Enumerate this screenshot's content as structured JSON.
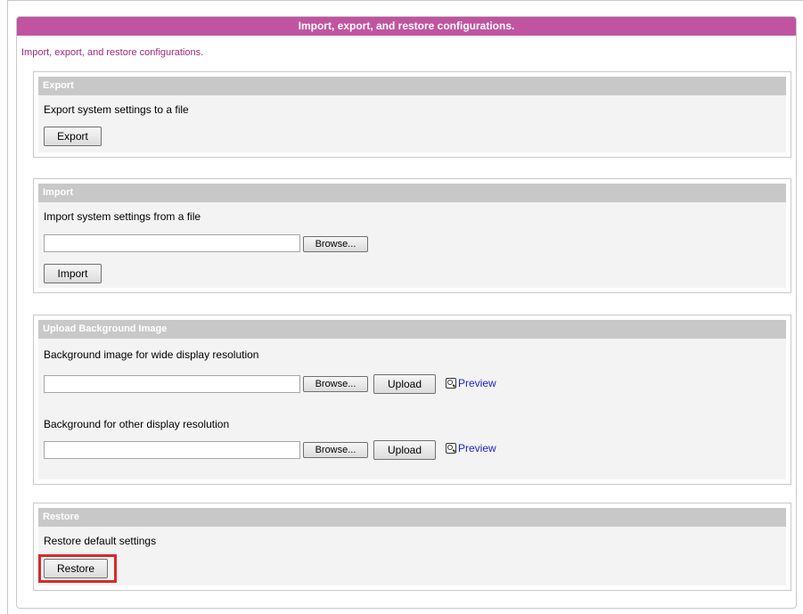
{
  "colors": {
    "header_bg": "#c154a0",
    "intro_text": "#a0287a",
    "section_head_bg": "#c8c8c8",
    "link": "#2222cc",
    "highlight": "#d82a2a"
  },
  "header": {
    "title": "Import, export, and restore configurations."
  },
  "intro": "Import, export, and restore configurations.",
  "export": {
    "title": "Export",
    "description": "Export system settings to a file",
    "button": "Export"
  },
  "import": {
    "title": "Import",
    "description": "Import system settings from a file",
    "browse": "Browse...",
    "button": "Import"
  },
  "upload": {
    "title": "Upload Background Image",
    "wide_label": "Background image for wide display resolution",
    "other_label": "Background for other display resolution",
    "browse": "Browse...",
    "upload": "Upload",
    "preview": "Preview"
  },
  "restore": {
    "title": "Restore",
    "description": "Restore default settings",
    "button": "Restore"
  }
}
